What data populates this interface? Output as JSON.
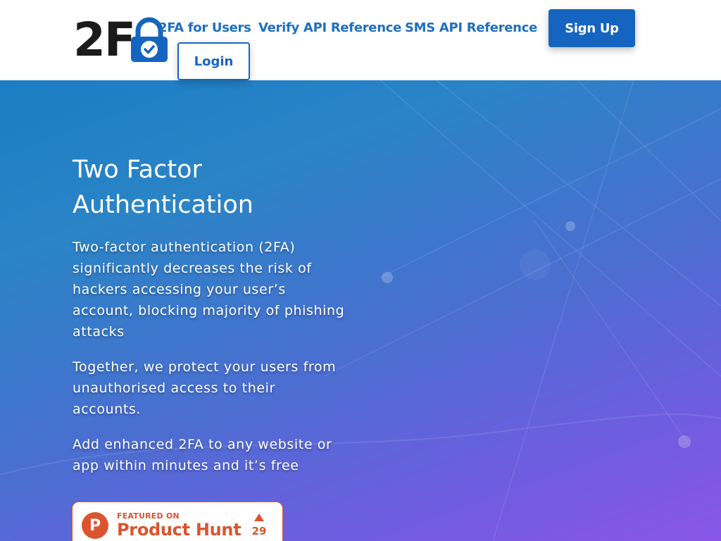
{
  "header": {
    "logo_text": "2F",
    "nav": [
      {
        "label": "2FA for Users"
      },
      {
        "label": "Verify API Reference"
      },
      {
        "label": "SMS API Reference"
      }
    ],
    "signup_label": "Sign Up",
    "login_label": "Login"
  },
  "hero": {
    "title": "Two Factor Authentication",
    "paragraphs": [
      "Two-factor authentication (2FA) significantly decreases the risk of hackers accessing your user’s account, blocking majority of phishing attacks",
      "Together, we protect your users from unauthorised access to their accounts.",
      "Add enhanced 2FA to any website or app within minutes and it’s free"
    ]
  },
  "product_hunt": {
    "logo_letter": "P",
    "featured": "FEATURED ON",
    "name": "Product Hunt",
    "votes": "29"
  },
  "colors": {
    "accent": "#1565c0",
    "product_hunt": "#da552f"
  }
}
